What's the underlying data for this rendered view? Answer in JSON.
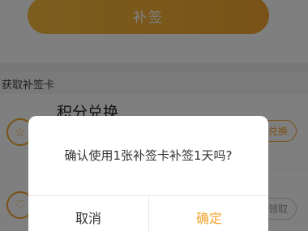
{
  "page": {
    "retro_button_label": "补签",
    "section_title": "获取补签卡",
    "list": [
      {
        "icon": "star-icon",
        "title": "积分兑换",
        "action_label": "兑换"
      },
      {
        "icon": "heart-icon",
        "title": "",
        "action_label": "领取"
      }
    ]
  },
  "dialog": {
    "message": "确认使用1张补签卡补签1天吗?",
    "cancel_label": "取消",
    "confirm_label": "确定"
  },
  "colors": {
    "accent": "#f2a52e",
    "overlay": "rgba(0,0,0,0.5)"
  }
}
